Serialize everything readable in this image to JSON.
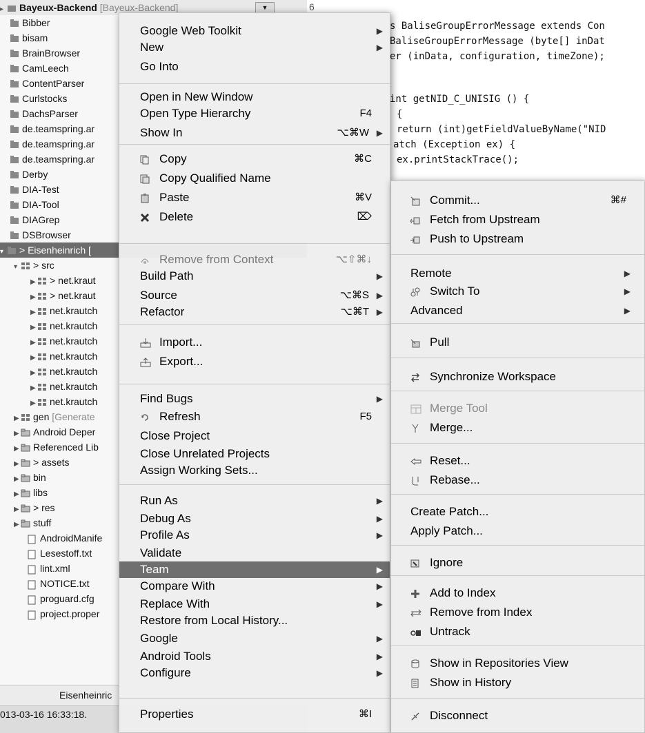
{
  "explorer": {
    "top_project": "Bayeux-Backend",
    "top_project_suffix": "[Bayeux-Backend]",
    "line_number": "6",
    "items": [
      {
        "label": "Bibber"
      },
      {
        "label": "bisam"
      },
      {
        "label": "BrainBrowser"
      },
      {
        "label": "CamLeech"
      },
      {
        "label": "ContentParser"
      },
      {
        "label": "Curlstocks"
      },
      {
        "label": "DachsParser"
      },
      {
        "label": "de.teamspring.ar"
      },
      {
        "label": "de.teamspring.ar"
      },
      {
        "label": "de.teamspring.ar"
      },
      {
        "label": "Derby"
      },
      {
        "label": "DIA-Test"
      },
      {
        "label": "DIA-Tool"
      },
      {
        "label": "DIAGrep"
      },
      {
        "label": "DSBrowser"
      }
    ],
    "selected_project": "> Eisenheinrich [",
    "src": "> src",
    "packages": [
      "> net.kraut",
      "> net.kraut",
      "net.krautch",
      "net.krautch",
      "net.krautch",
      "net.krautch",
      "net.krautch",
      "net.krautch",
      "net.krautch"
    ],
    "gen": "gen",
    "gen_suffix": "[Generate",
    "folders": [
      "Android Deper",
      "Referenced Lib",
      "> assets",
      "bin",
      "libs",
      "> res",
      "stuff"
    ],
    "files": [
      "AndroidManife",
      "Lesestoff.txt",
      "lint.xml",
      "NOTICE.txt",
      "proguard.cfg",
      "project.proper"
    ],
    "bottom_tab": "Eisenheinric",
    "status": "013-03-16 16:33:18."
  },
  "editor": {
    "lines": [
      "s BaliseGroupErrorMessage extends Con",
      "BaliseGroupErrorMessage (byte[] inDat",
      "er (inData, configuration, timeZone);",
      "int getNID_C_UNISIG () {",
      "{",
      "return (int)getFieldValueByName(\"NID",
      "atch (Exception ex) {",
      "ex.printStackTrace();"
    ]
  },
  "main_menu": {
    "items": [
      {
        "label": "Google Web Toolkit",
        "arrow": "▶"
      },
      {
        "label": "New",
        "arrow": "▶"
      },
      {
        "label": "Go Into"
      },
      {
        "label": "Open in New Window"
      },
      {
        "label": "Open Type Hierarchy",
        "shortcut": "F4"
      },
      {
        "label": "Show In",
        "shortcut": "⌥⌘W",
        "arrow": "▶"
      },
      {
        "label": "Copy",
        "shortcut": "⌘C",
        "icon": "copy-icon"
      },
      {
        "label": "Copy Qualified Name",
        "icon": "copy-qualified-name-icon"
      },
      {
        "label": "Paste",
        "shortcut": "⌘V",
        "icon": "paste-icon"
      },
      {
        "label": "Delete",
        "shortcut": "⌦",
        "icon": "delete-icon"
      },
      {
        "label": "Remove from Context",
        "shortcut": "⌥⇧⌘↓",
        "icon": "remove-context-icon",
        "disabled": true
      },
      {
        "label": "Build Path",
        "arrow": "▶"
      },
      {
        "label": "Source",
        "shortcut": "⌥⌘S",
        "arrow": "▶"
      },
      {
        "label": "Refactor",
        "shortcut": "⌥⌘T",
        "arrow": "▶"
      },
      {
        "label": "Import...",
        "icon": "import-icon"
      },
      {
        "label": "Export...",
        "icon": "export-icon"
      },
      {
        "label": "Find Bugs",
        "arrow": "▶"
      },
      {
        "label": "Refresh",
        "shortcut": "F5",
        "icon": "refresh-icon"
      },
      {
        "label": "Close Project"
      },
      {
        "label": "Close Unrelated Projects"
      },
      {
        "label": "Assign Working Sets..."
      },
      {
        "label": "Run As",
        "arrow": "▶"
      },
      {
        "label": "Debug As",
        "arrow": "▶"
      },
      {
        "label": "Profile As",
        "arrow": "▶"
      },
      {
        "label": "Validate"
      },
      {
        "label": "Team",
        "arrow": "▶",
        "highlighted": true
      },
      {
        "label": "Compare With",
        "arrow": "▶"
      },
      {
        "label": "Replace With",
        "arrow": "▶"
      },
      {
        "label": "Restore from Local History..."
      },
      {
        "label": "Google",
        "arrow": "▶"
      },
      {
        "label": "Android Tools",
        "arrow": "▶"
      },
      {
        "label": "Configure",
        "arrow": "▶"
      },
      {
        "label": "Properties",
        "shortcut": "⌘I"
      }
    ]
  },
  "team_menu": {
    "items": [
      {
        "label": "Commit...",
        "shortcut": "⌘#",
        "icon": "commit-icon"
      },
      {
        "label": "Fetch from Upstream",
        "icon": "fetch-icon"
      },
      {
        "label": "Push to Upstream",
        "icon": "push-icon"
      },
      {
        "label": "Remote",
        "arrow": "▶"
      },
      {
        "label": "Switch To",
        "arrow": "▶",
        "icon": "switch-branch-icon"
      },
      {
        "label": "Advanced",
        "arrow": "▶"
      },
      {
        "label": "Pull",
        "icon": "pull-icon"
      },
      {
        "label": "Synchronize Workspace",
        "icon": "synchronize-icon"
      },
      {
        "label": "Merge Tool",
        "icon": "merge-tool-icon",
        "disabled": true
      },
      {
        "label": "Merge...",
        "icon": "merge-icon"
      },
      {
        "label": "Reset...",
        "icon": "reset-icon"
      },
      {
        "label": "Rebase...",
        "icon": "rebase-icon"
      },
      {
        "label": "Create Patch..."
      },
      {
        "label": "Apply Patch..."
      },
      {
        "label": "Ignore",
        "icon": "ignore-icon"
      },
      {
        "label": "Add to Index",
        "icon": "add-to-index-icon"
      },
      {
        "label": "Remove from Index",
        "icon": "remove-from-index-icon"
      },
      {
        "label": "Untrack",
        "icon": "untrack-icon"
      },
      {
        "label": "Show in Repositories View",
        "icon": "repositories-view-icon"
      },
      {
        "label": "Show in History",
        "icon": "history-icon"
      },
      {
        "label": "Disconnect",
        "icon": "disconnect-icon"
      }
    ]
  }
}
